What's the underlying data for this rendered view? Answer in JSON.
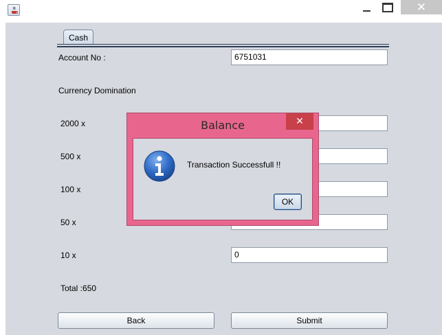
{
  "window": {
    "min_icon": "minimize-icon",
    "max_icon": "maximize-icon",
    "close_glyph": "✕"
  },
  "tab": {
    "label": "Cash"
  },
  "form": {
    "account_label": "Account No :",
    "account_value": "6751031",
    "currency_label": "Currency Domination",
    "rows": [
      {
        "label": "2000 x",
        "value": ""
      },
      {
        "label": "500 x",
        "value": ""
      },
      {
        "label": "100 x",
        "value": ""
      },
      {
        "label": "50 x",
        "value": ""
      },
      {
        "label": "10 x",
        "value": "0"
      }
    ],
    "total": "Total :650"
  },
  "buttons": {
    "back": "Back",
    "submit": "Submit"
  },
  "dialog": {
    "title": "Balance",
    "close_glyph": "✕",
    "message": "Transaction Successfull !!",
    "ok": "OK",
    "icon": "info-icon"
  },
  "colors": {
    "dialog_frame": "#e8668e",
    "dialog_close": "#c8404a",
    "panel": "#d6d9df",
    "info_icon": "#2f6bc6"
  }
}
